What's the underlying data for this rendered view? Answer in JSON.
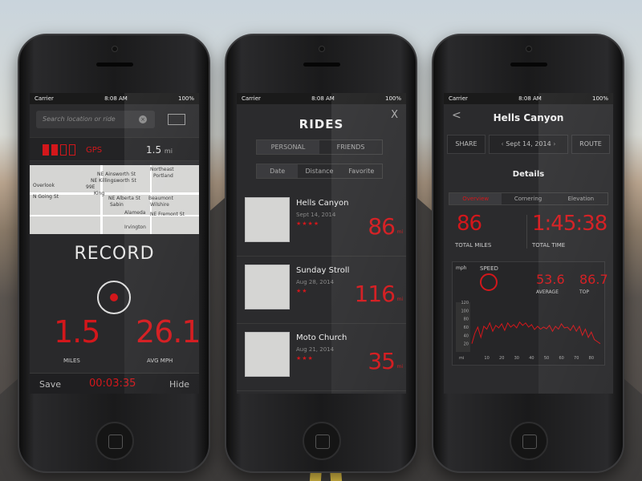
{
  "background": {
    "description": "road"
  },
  "colors": {
    "accent": "#d3171b",
    "screen_bg": "#2b2b2d"
  },
  "status_bar": {
    "carrier": "Carrier",
    "time": "8:08 AM",
    "battery": "100%"
  },
  "phone1": {
    "search_placeholder": "Search location or ride",
    "gps_label": "GPS",
    "gps_strength": 2,
    "distance_value": "1.5",
    "distance_unit": "mi",
    "map_labels": [
      "Northeast",
      "Portland",
      "NE Ainsworth St",
      "NE Killingsworth St",
      "Overlook",
      "N Going St",
      "99E",
      "King",
      "NE Alberta St",
      "Sabin",
      "Beaumont",
      "Wilshire",
      "Alameda",
      "NE Fremont St",
      "Irvington"
    ],
    "record_label": "RECORD",
    "miles_value": "1.5",
    "miles_label": "MILES",
    "avg_value": "26.1",
    "avg_label": "AVG MPH",
    "save_label": "Save",
    "timer": "00:03:35",
    "hide_label": "Hide"
  },
  "phone2": {
    "title": "RIDES",
    "close_label": "X",
    "tabs": [
      "PERSONAL",
      "FRIENDS"
    ],
    "sort_tabs": [
      "Date",
      "Distance",
      "Favorite"
    ],
    "rides": [
      {
        "name": "Hells Canyon",
        "date": "Sept 14, 2014",
        "stars": "★★★★",
        "miles": "86",
        "unit": "mi"
      },
      {
        "name": "Sunday Stroll",
        "date": "Aug 28, 2014",
        "stars": "★★",
        "miles": "116",
        "unit": "mi"
      },
      {
        "name": "Moto Church",
        "date": "Aug 21, 2014",
        "stars": "★★★",
        "miles": "35",
        "unit": "mi"
      }
    ]
  },
  "phone3": {
    "back_label": "<",
    "title": "Hells Canyon",
    "share_label": "SHARE",
    "date_label": "Sept 14, 2014",
    "route_label": "ROUTE",
    "details_label": "Details",
    "tabs": [
      "Overview",
      "Cornering",
      "Elevation"
    ],
    "total_miles_value": "86",
    "total_miles_label": "TOTAL MILES",
    "total_time_value": "1:45:38",
    "total_time_label": "TOTAL TIME",
    "speed_label": "SPEED",
    "unit_label": "mph",
    "average_value": "53.6",
    "average_label": "AVERAGE",
    "top_value": "86.7",
    "top_label": "TOP",
    "x_unit": "mi"
  },
  "chart_data": {
    "type": "line",
    "title": "SPEED",
    "xlabel": "mi",
    "ylabel": "mph",
    "y_ticks": [
      20,
      40,
      60,
      80,
      100,
      120
    ],
    "x_ticks": [
      10,
      20,
      30,
      40,
      50,
      60,
      70,
      80
    ],
    "xlim": [
      0,
      86
    ],
    "ylim": [
      0,
      120
    ],
    "series": [
      {
        "values": [
          [
            0,
            20
          ],
          [
            2,
            45
          ],
          [
            4,
            60
          ],
          [
            6,
            35
          ],
          [
            8,
            62
          ],
          [
            10,
            55
          ],
          [
            12,
            70
          ],
          [
            14,
            50
          ],
          [
            16,
            64
          ],
          [
            18,
            58
          ],
          [
            20,
            68
          ],
          [
            22,
            52
          ],
          [
            24,
            70
          ],
          [
            26,
            60
          ],
          [
            28,
            66
          ],
          [
            30,
            58
          ],
          [
            32,
            72
          ],
          [
            34,
            64
          ],
          [
            36,
            70
          ],
          [
            38,
            60
          ],
          [
            40,
            66
          ],
          [
            42,
            54
          ],
          [
            44,
            62
          ],
          [
            46,
            55
          ],
          [
            48,
            60
          ],
          [
            50,
            56
          ],
          [
            52,
            64
          ],
          [
            54,
            50
          ],
          [
            56,
            62
          ],
          [
            58,
            55
          ],
          [
            60,
            68
          ],
          [
            62,
            58
          ],
          [
            64,
            60
          ],
          [
            66,
            52
          ],
          [
            68,
            64
          ],
          [
            70,
            50
          ],
          [
            72,
            62
          ],
          [
            74,
            40
          ],
          [
            76,
            55
          ],
          [
            78,
            35
          ],
          [
            80,
            48
          ],
          [
            82,
            30
          ],
          [
            84,
            25
          ],
          [
            86,
            20
          ]
        ]
      }
    ]
  }
}
